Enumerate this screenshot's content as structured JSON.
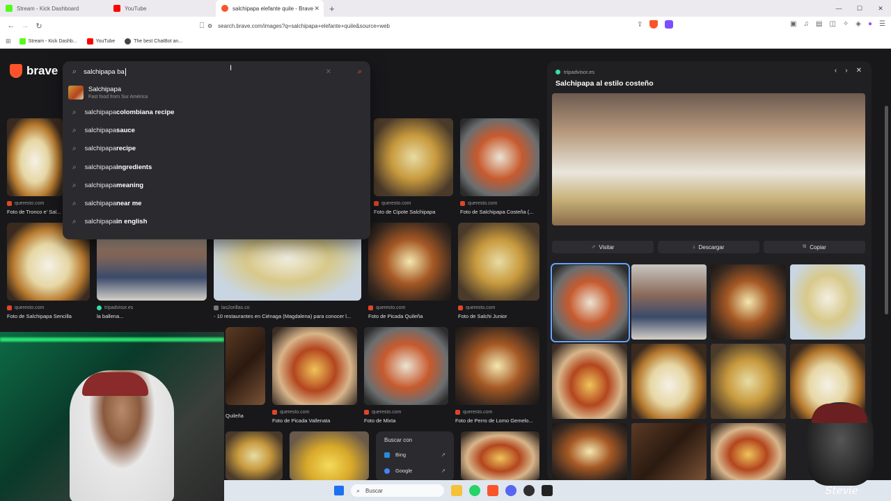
{
  "tabs": [
    {
      "label": "Stream - Kick Dashboard",
      "color": "#53fc18"
    },
    {
      "label": "YouTube",
      "color": "#ff0000"
    },
    {
      "label": "salchipapa elefante quile - Brave",
      "color": "#fb542b"
    }
  ],
  "address": {
    "url": "search.brave.com/images?q=salchipapa+elefante+quile&source=web"
  },
  "bookmarks": [
    {
      "label": "Stream - Kick Dashb...",
      "color": "#53fc18"
    },
    {
      "label": "YouTube",
      "color": "#ff0000"
    },
    {
      "label": "The best ChatBot an...",
      "color": "#444444"
    }
  ],
  "brand": {
    "name": "brave",
    "color": "#fb542b"
  },
  "search": {
    "query": "salchipapa ba",
    "rich": {
      "title": "Salchipapa",
      "subtitle": "Fast food from Sur América"
    },
    "suggestions": [
      {
        "base": "salchipapa ",
        "bold": "colombiana recipe"
      },
      {
        "base": "salchipapa ",
        "bold": "sauce"
      },
      {
        "base": "salchipapa ",
        "bold": "recipe"
      },
      {
        "base": "salchipapa ",
        "bold": "ingredients"
      },
      {
        "base": "salchipapa ",
        "bold": "meaning"
      },
      {
        "base": "salchipapa ",
        "bold": "near me"
      },
      {
        "base": "salchipapa ",
        "bold": "in english"
      }
    ]
  },
  "grid": {
    "row1": [
      {
        "src": "queresto.com",
        "cap": "Foto de Tronco e' Sal..."
      },
      {
        "src": "queresto.com",
        "cap": "Foto de Cipote Salchipapa"
      },
      {
        "src": "queresto.com",
        "cap": "Foto de Salchipapa Costeña (..."
      }
    ],
    "row2": [
      {
        "src": "queresto.com",
        "cap": "Foto de Salchipapa Sencilla"
      },
      {
        "src": "tripadvisor.es",
        "cap": "la ballena..."
      },
      {
        "src": "las2orillas.co",
        "cap": "- 10 restaurantes en Ciénaga (Magdalena) para conocer l..."
      },
      {
        "src": "queresto.com",
        "cap": "Foto de Picada Quileña"
      },
      {
        "src": "queresto.com",
        "cap": "Foto de Salchi Junior"
      }
    ],
    "row3": [
      {
        "src": "",
        "cap": "Quileña"
      },
      {
        "src": "queresto.com",
        "cap": "Foto de Picada Vallenata"
      },
      {
        "src": "queresto.com",
        "cap": "Foto de Mixta"
      },
      {
        "src": "queresto.com",
        "cap": "Foto de Perro de Lomo Gemelo..."
      }
    ]
  },
  "search_with": {
    "heading": "Buscar con",
    "items": [
      {
        "label": "Bing",
        "color": "#2a8bd8"
      },
      {
        "label": "Google",
        "color": "#4285f4"
      }
    ]
  },
  "viewer": {
    "source": "tripadvisor.es",
    "title": "Salchipapa al estilo costeño",
    "buttons": {
      "visit": "Visitar",
      "download": "Descargar",
      "copy": "Copiar"
    }
  },
  "taskbar": {
    "search_label": "Buscar"
  },
  "overlay": {
    "signature": "Stevie"
  }
}
